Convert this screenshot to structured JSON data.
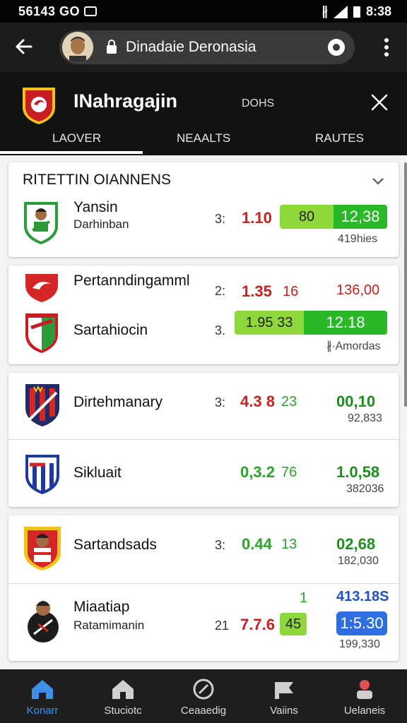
{
  "status": {
    "left": "56143 GO",
    "time": "8:38"
  },
  "browser": {
    "url": "Dinadaie Deronasia"
  },
  "header": {
    "title": "INahragajin",
    "subtitle": "DOHS",
    "tabs": [
      "LAOVER",
      "NEAALTS",
      "RAUTES"
    ]
  },
  "sections": {
    "title": "RITETTIN OIANNENS"
  },
  "matches": [
    {
      "name": "Yansin",
      "sub": "Darhinban",
      "n": "3:",
      "odd": "1.10",
      "bar_left": "80",
      "bar_right": "12,38",
      "foot": "419hies"
    },
    {
      "name": "Pertanndingamml",
      "n": "2:",
      "odd": "1.35",
      "odd2": "16",
      "value": "136,00"
    },
    {
      "name": "Sartahiocin",
      "n": "3.",
      "bar_left": "1.95 33",
      "bar_right": "12.18",
      "foot": "∦∙Amordas"
    },
    {
      "name": "Dirtehmanary",
      "n": "3:",
      "odd": "4.3 8",
      "odd2": "23",
      "value": "00,10",
      "foot": "92,833"
    },
    {
      "name": "Sikluait",
      "odd": "0,3.2",
      "odd2": "76",
      "value": "1.0,58",
      "foot": "382036"
    },
    {
      "name": "Sartandsads",
      "n": "3:",
      "odd": "0.44",
      "odd2": "13",
      "value": "02,68",
      "foot": "182,030"
    },
    {
      "name": "Miaatiap",
      "sub": "Ratamimanin",
      "top": "1",
      "n": "21",
      "odd": "7.7.6",
      "chip": "45",
      "value_top": "413.18S",
      "chip_value": "1:5.30",
      "foot": "199,330"
    }
  ],
  "nav": [
    "Konarr",
    "Stuciotc",
    "Ceaaedig",
    "Vaiins",
    "Uelaneis"
  ],
  "colors": {
    "accent_green": "#28b828",
    "light_green": "#8fd83c",
    "odds_red": "#cc1f1f",
    "nav_active": "#3f8fe8"
  }
}
